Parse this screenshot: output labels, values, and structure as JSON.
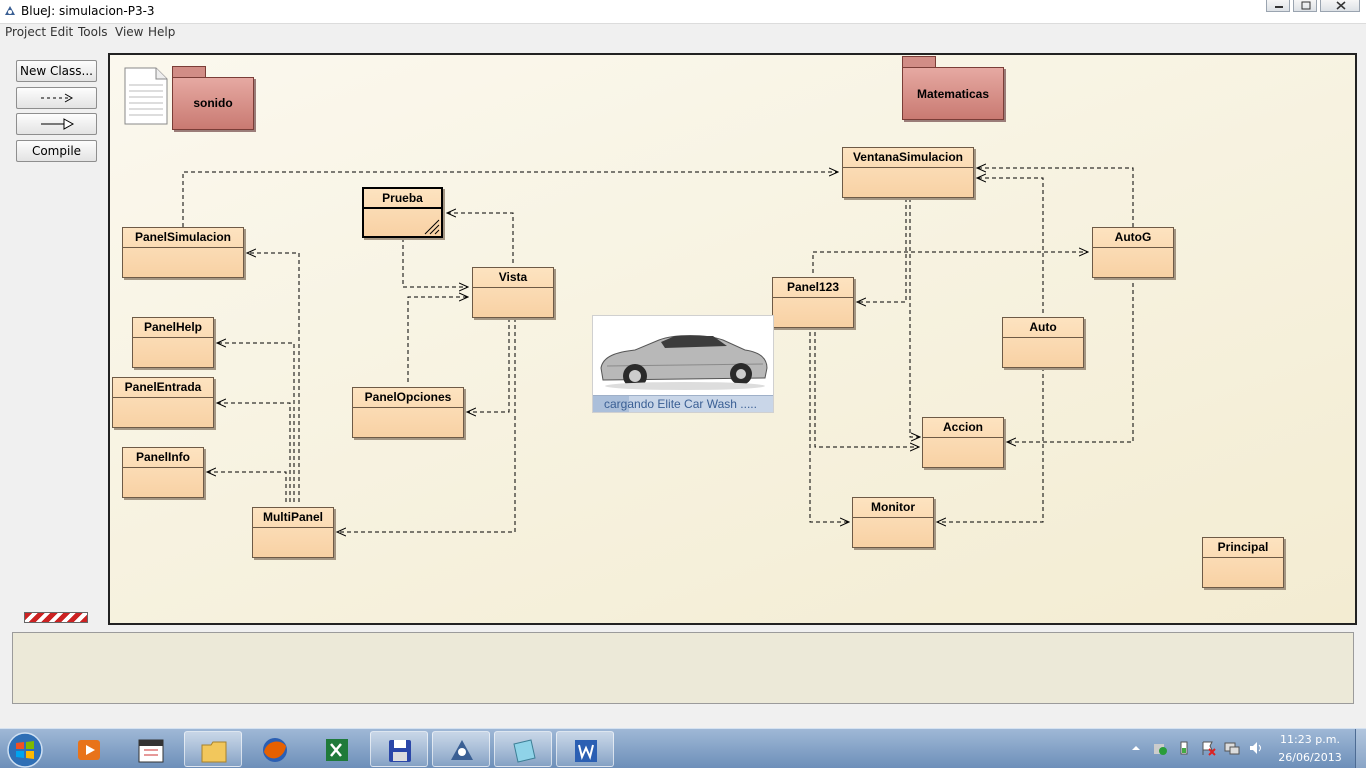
{
  "window": {
    "title": "BlueJ:  simulacion-P3-3"
  },
  "menu": {
    "items": [
      "Project",
      "Edit",
      "Tools",
      "View",
      "Help"
    ]
  },
  "toolbar": {
    "new_class_label": "New Class...",
    "dependency_arrow_icon": "dashed-arrow-icon",
    "inheritance_arrow_icon": "hollow-arrow-icon",
    "compile_label": "Compile"
  },
  "packages": {
    "sonido": "sonido",
    "matematicas": "Matematicas"
  },
  "classes": {
    "ventana_simulacion": "VentanaSimulacion",
    "prueba": "Prueba",
    "panel_simulacion": "PanelSimulacion",
    "vista": "Vista",
    "autog": "AutoG",
    "panel123": "Panel123",
    "auto": "Auto",
    "panel_help": "PanelHelp",
    "panel_entrada": "PanelEntrada",
    "panel_opciones": "PanelOpciones",
    "accion": "Accion",
    "panel_info": "PanelInfo",
    "multi_panel": "MultiPanel",
    "monitor": "Monitor",
    "principal": "Principal"
  },
  "splash": {
    "text": "cargando Elite Car Wash ....."
  },
  "taskbar": {
    "apps": [
      "media-player-icon",
      "media-center-icon",
      "file-explorer-icon",
      "firefox-icon",
      "excel-icon",
      "floppy-save-icon",
      "bluej-icon",
      "notepad-icon",
      "word-icon"
    ]
  },
  "tray": {
    "icons": [
      "show-hidden-icons-icon",
      "security-icon",
      "battery-icon",
      "flag-alert-icon",
      "network-icon",
      "volume-icon"
    ],
    "time": "11:23 p.m.",
    "date": "26/06/2013"
  },
  "colors": {
    "class_fill": "#f8d1a4",
    "package_fill": "#d18d86",
    "canvas_bg": "#f6f1dd"
  }
}
